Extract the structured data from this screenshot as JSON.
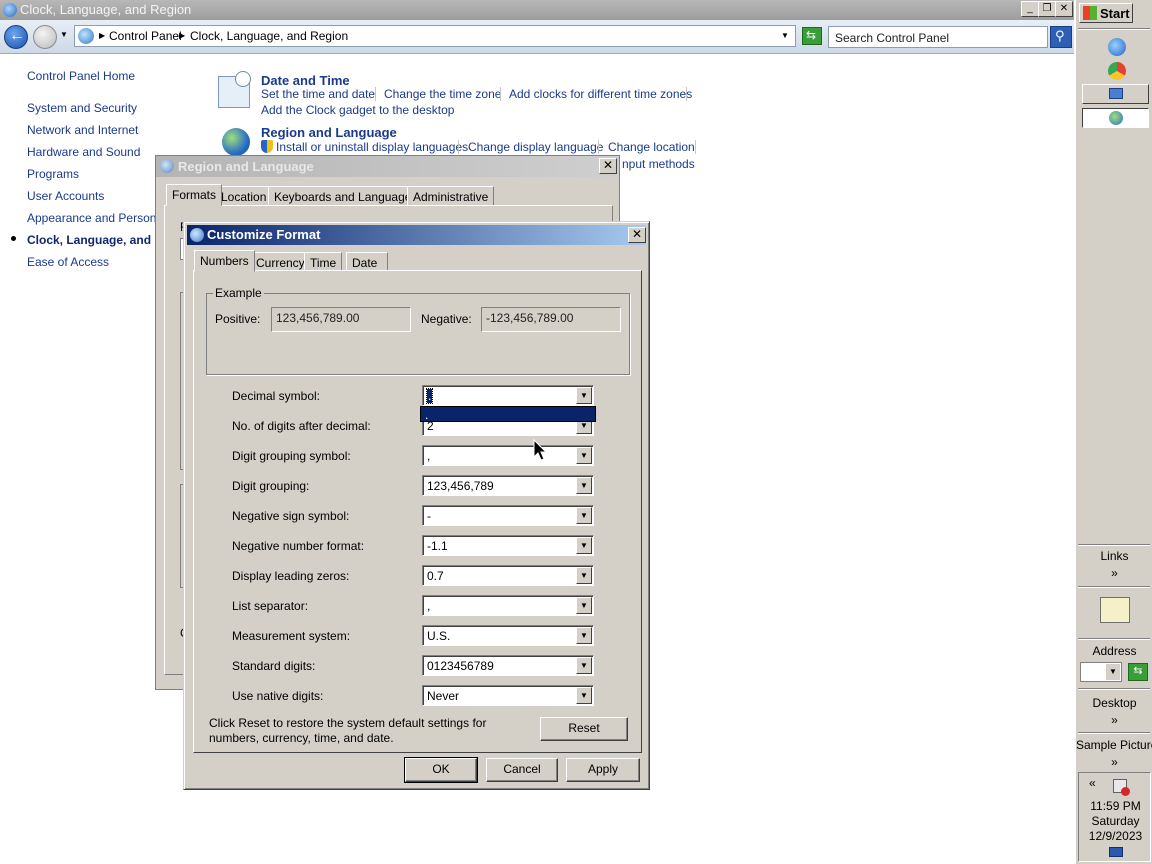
{
  "window": {
    "title": "Clock, Language, and Region"
  },
  "address": {
    "breadcrumb": [
      "Control Panel",
      "Clock, Language, and Region"
    ],
    "search_placeholder": "Search Control Panel"
  },
  "left_nav": {
    "home": "Control Panel Home",
    "items": [
      "System and Security",
      "Network and Internet",
      "Hardware and Sound",
      "Programs",
      "User Accounts",
      "Appearance and Personaliz",
      "Clock, Language, and R",
      "Ease of Access"
    ],
    "active_index": 6
  },
  "categories": {
    "date_time": {
      "title": "Date and Time",
      "links": [
        "Set the time and date",
        "Change the time zone",
        "Add clocks for different time zones",
        "Add the Clock gadget to the desktop"
      ]
    },
    "region_language": {
      "title": "Region and Language",
      "links": [
        "Install or uninstall display languages",
        "Change display language",
        "Change location",
        "nput methods"
      ]
    }
  },
  "region_dialog": {
    "title": "Region and Language",
    "tabs": [
      "Formats",
      "Location",
      "Keyboards and Languages",
      "Administrative"
    ],
    "partial_text": [
      "F",
      "C"
    ]
  },
  "customize_dialog": {
    "title": "Customize Format",
    "tabs": [
      "Numbers",
      "Currency",
      "Time",
      "Date"
    ],
    "example": {
      "legend": "Example",
      "positive_label": "Positive:",
      "positive_value": "123,456,789.00",
      "negative_label": "Negative:",
      "negative_value": "-123,456,789.00"
    },
    "rows": [
      {
        "label": "Decimal symbol:",
        "value": "."
      },
      {
        "label": "No. of digits after decimal:",
        "value": "2"
      },
      {
        "label": "Digit grouping symbol:",
        "value": ","
      },
      {
        "label": "Digit grouping:",
        "value": "123,456,789"
      },
      {
        "label": "Negative sign symbol:",
        "value": "-"
      },
      {
        "label": "Negative number format:",
        "value": "-1.1"
      },
      {
        "label": "Display leading zeros:",
        "value": "0.7"
      },
      {
        "label": "List separator:",
        "value": ","
      },
      {
        "label": "Measurement system:",
        "value": "U.S."
      },
      {
        "label": "Standard digits:",
        "value": "0123456789"
      },
      {
        "label": "Use native digits:",
        "value": "Never"
      }
    ],
    "dropdown_open_option": ".",
    "reset_note": "Click Reset to restore the system default settings for numbers, currency, time, and date.",
    "buttons": {
      "reset": "Reset",
      "ok": "OK",
      "cancel": "Cancel",
      "apply": "Apply"
    }
  },
  "taskbar": {
    "start": "Start",
    "links": "Links",
    "chevron": "»",
    "address": "Address",
    "desktop": "Desktop",
    "sample_pictures": "Sample Pictures",
    "collapse": "«",
    "clock_time": "11:59 PM",
    "clock_day": "Saturday",
    "clock_date": "12/9/2023"
  },
  "colors": {
    "active_title": "#0a246a",
    "link": "#1a3a8c",
    "dialog_face": "#d4d0c8",
    "selection": "#0a246a"
  }
}
